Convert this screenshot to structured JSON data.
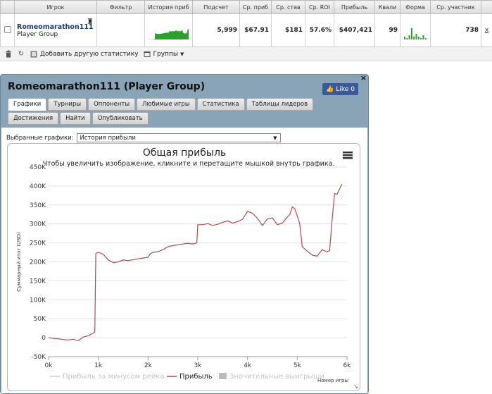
{
  "table": {
    "headers": [
      "",
      "Игрок",
      "Фильтр",
      "История приб",
      "Подсчет",
      "Ср. приб",
      "Ср. став",
      "Ср. ROI",
      "Прибыль",
      "Квали",
      "Форма",
      "Ср. участник",
      ""
    ],
    "row": {
      "player_name": "Romeomarathon111",
      "player_group": "Player Group",
      "filter": "",
      "count": "5,999",
      "avg_profit": "$67.91",
      "avg_stake": "$181",
      "avg_roi": "57.6%",
      "profit": "$407,421",
      "quali": "99",
      "avg_entrants": "738",
      "remove": "x"
    },
    "sparkline_color": "#2aa12a",
    "form_bars": [
      2,
      1,
      3,
      8,
      2,
      4,
      2,
      1,
      3,
      1
    ]
  },
  "toolbar": {
    "add_stats": "Добавить другую статистику",
    "groups": "Группы"
  },
  "dialog": {
    "title": "Romeomarathon111 (Player Group)",
    "like_label": "Like",
    "like_count": "0",
    "close": "×",
    "tabs_row1": [
      "Графики",
      "Турниры",
      "Оппоненты",
      "Любимые игры",
      "Статистика",
      "Таблицы лидеров"
    ],
    "tabs_row2": [
      "Достижения",
      "Найти",
      "Опубликовать"
    ],
    "active_tab": "Графики",
    "select_label": "Выбранные графики:",
    "select_value": "История прибыли"
  },
  "chart_data": {
    "type": "line",
    "title": "Общая прибыль",
    "subtitle": "Чтобы увеличить изображение, кликните и перетащите мышкой внутрь графика.",
    "ylabel": "Суммарный итог (USD)",
    "xlabel": "Номер игры",
    "xlim": [
      0,
      6000
    ],
    "ylim": [
      -50000,
      450000
    ],
    "x_ticks": [
      "0k",
      "1k",
      "2k",
      "3k",
      "4k",
      "5k",
      "6k"
    ],
    "y_ticks": [
      "-50K",
      "0",
      "50K",
      "100K",
      "150K",
      "200K",
      "250K",
      "300K",
      "350K",
      "400K",
      "450K"
    ],
    "grid": true,
    "legend_position": "bottom",
    "series": [
      {
        "name": "Прибыль за минусом рейка",
        "color": "#cccccc",
        "visible": false
      },
      {
        "name": "Прибыль",
        "color": "#b24a4a",
        "visible": true,
        "x": [
          0,
          100,
          200,
          300,
          400,
          500,
          600,
          700,
          800,
          900,
          930,
          950,
          1000,
          1100,
          1200,
          1300,
          1400,
          1500,
          1600,
          1700,
          1800,
          1900,
          2000,
          2050,
          2100,
          2200,
          2300,
          2400,
          2500,
          2600,
          2700,
          2800,
          2900,
          2980,
          3000,
          3100,
          3200,
          3300,
          3400,
          3500,
          3600,
          3700,
          3800,
          3900,
          4000,
          4100,
          4200,
          4300,
          4400,
          4500,
          4600,
          4700,
          4800,
          4850,
          4900,
          4950,
          5000,
          5050,
          5100,
          5200,
          5300,
          5400,
          5500,
          5600,
          5650,
          5700,
          5750,
          5800,
          5850,
          5900
        ],
        "y": [
          0,
          -2000,
          -3000,
          -5000,
          -6000,
          -4000,
          -8000,
          2000,
          5000,
          12000,
          15000,
          222000,
          225000,
          220000,
          205000,
          198000,
          200000,
          205000,
          203000,
          206000,
          208000,
          210000,
          212000,
          222000,
          225000,
          227000,
          232000,
          240000,
          243000,
          245000,
          247000,
          249000,
          247000,
          250000,
          298000,
          298000,
          301000,
          296000,
          299000,
          304000,
          308000,
          302000,
          306000,
          312000,
          333000,
          328000,
          315000,
          296000,
          313000,
          316000,
          298000,
          302000,
          318000,
          325000,
          345000,
          340000,
          322000,
          300000,
          240000,
          228000,
          218000,
          215000,
          232000,
          226000,
          230000,
          310000,
          380000,
          378000,
          392000,
          405000
        ]
      },
      {
        "name": "Значительные выигрыши",
        "color": "#bbbbbb",
        "visible": false
      }
    ]
  }
}
